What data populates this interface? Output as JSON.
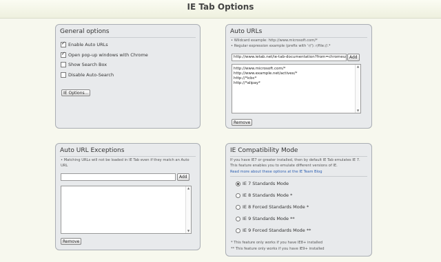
{
  "header": {
    "title": "IE Tab Options"
  },
  "general": {
    "title": "General options",
    "options": [
      {
        "label": "Enable Auto URLs",
        "checked": true
      },
      {
        "label": "Open pop-up windows with Chrome",
        "checked": true
      },
      {
        "label": "Show Search Box",
        "checked": false
      },
      {
        "label": "Disable Auto-Search",
        "checked": false
      }
    ],
    "ie_options_button": "IE Options..."
  },
  "auto_urls": {
    "title": "Auto URLs",
    "hints": [
      "• Wildcard example: http://www.microsoft.com/*",
      "• Regular expression example (prefix with 'r/'): r/file://.*"
    ],
    "input_value": "http://www.ietab.net/ie-tab-documentation?from=chromeurls",
    "add_button": "Add",
    "list": [
      "http://www.microsoft.com/*",
      "http://www.example.net/activex/*",
      "http://*icbc*",
      "http://*alipay*"
    ],
    "remove_button": "Remove"
  },
  "exceptions": {
    "title": "Auto URL Exceptions",
    "hint": "• Matching URLs will not be loaded in IE Tab even if they match an Auto URL",
    "input_value": "",
    "add_button": "Add",
    "list": [],
    "remove_button": "Remove"
  },
  "compat": {
    "title": "IE Compatibility Mode",
    "description": "If you have IE7 or greater installed, then by default IE Tab emulates IE 7. This feature enables you to emulate different versions of IE.",
    "blog_link": "Read more about these options at the IE Team Blog",
    "modes": [
      {
        "label": "IE 7 Standards Mode",
        "selected": true
      },
      {
        "label": "IE 8 Standards Mode *",
        "selected": false
      },
      {
        "label": "IE 8 Forced Standards Mode *",
        "selected": false
      },
      {
        "label": "IE 9 Standards Mode **",
        "selected": false
      },
      {
        "label": "IE 9 Forced Standards Mode **",
        "selected": false
      }
    ],
    "footnote1": "* This feature only works if you have IE8+ installed",
    "footnote2": "** This feature only works if you have IE9+ installed"
  }
}
